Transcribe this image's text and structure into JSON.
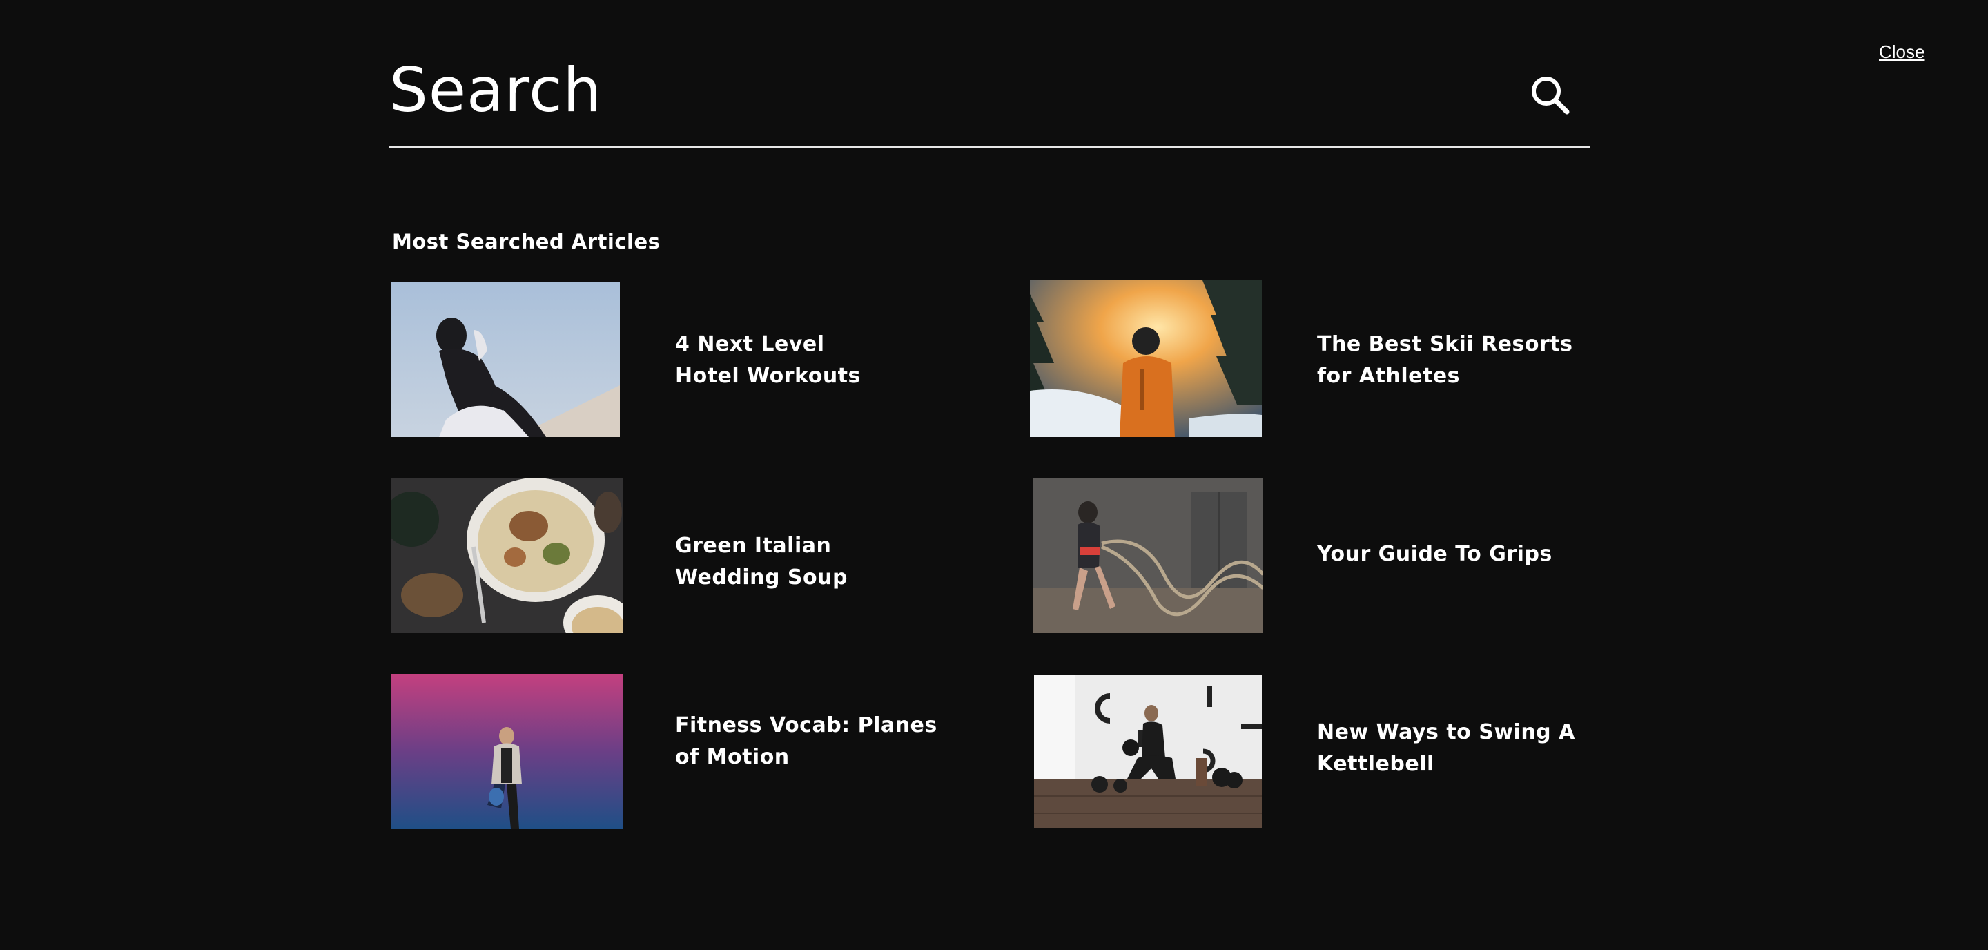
{
  "header": {
    "search_placeholder": "Search",
    "close_label": "Close"
  },
  "section": {
    "title": "Most Searched Articles"
  },
  "articles": [
    {
      "title": "4 Next Level Hotel Workouts",
      "image": "athlete-stretching-photo"
    },
    {
      "title": "The Best Skii Resorts for Athletes",
      "image": "skier-sunset-photo"
    },
    {
      "title": "Green Italian Wedding Soup",
      "image": "soup-bowl-photo"
    },
    {
      "title": "Your Guide To Grips",
      "image": "battle-ropes-photo"
    },
    {
      "title": "Fitness Vocab: Planes of Motion",
      "image": "woman-pink-wall-photo"
    },
    {
      "title": "New Ways to Swing A Kettlebell",
      "image": "kettlebell-squat-photo"
    }
  ]
}
